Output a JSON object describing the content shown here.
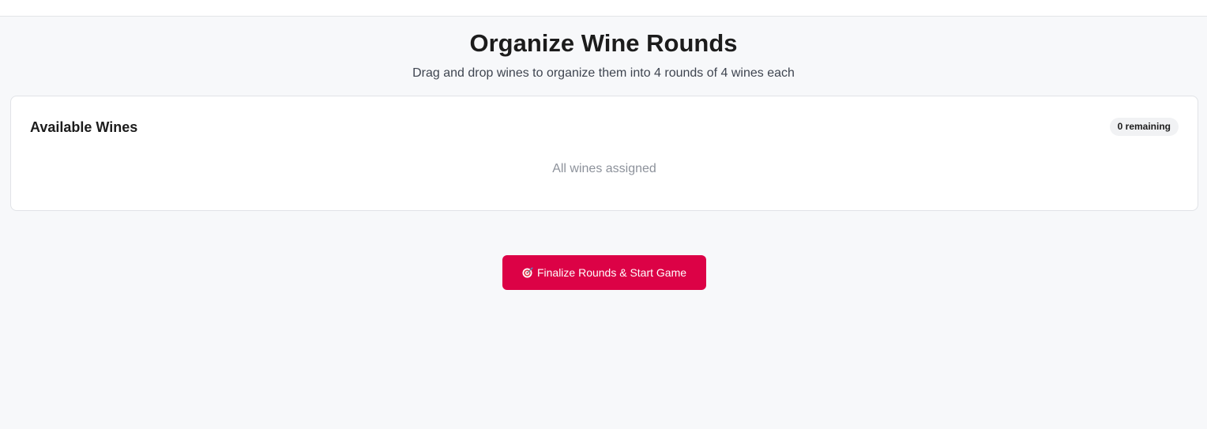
{
  "header": {
    "title": "Organize Wine Rounds",
    "subtitle": "Drag and drop wines to organize them into 4 rounds of 4 wines each"
  },
  "available_wines": {
    "title": "Available Wines",
    "remaining_badge": "0 remaining",
    "empty_message": "All wines assigned"
  },
  "actions": {
    "finalize_icon": "dart-target-icon",
    "finalize_label": "Finalize Rounds & Start Game"
  },
  "colors": {
    "accent": "#dc0246",
    "page_background": "#f7f8fa"
  }
}
